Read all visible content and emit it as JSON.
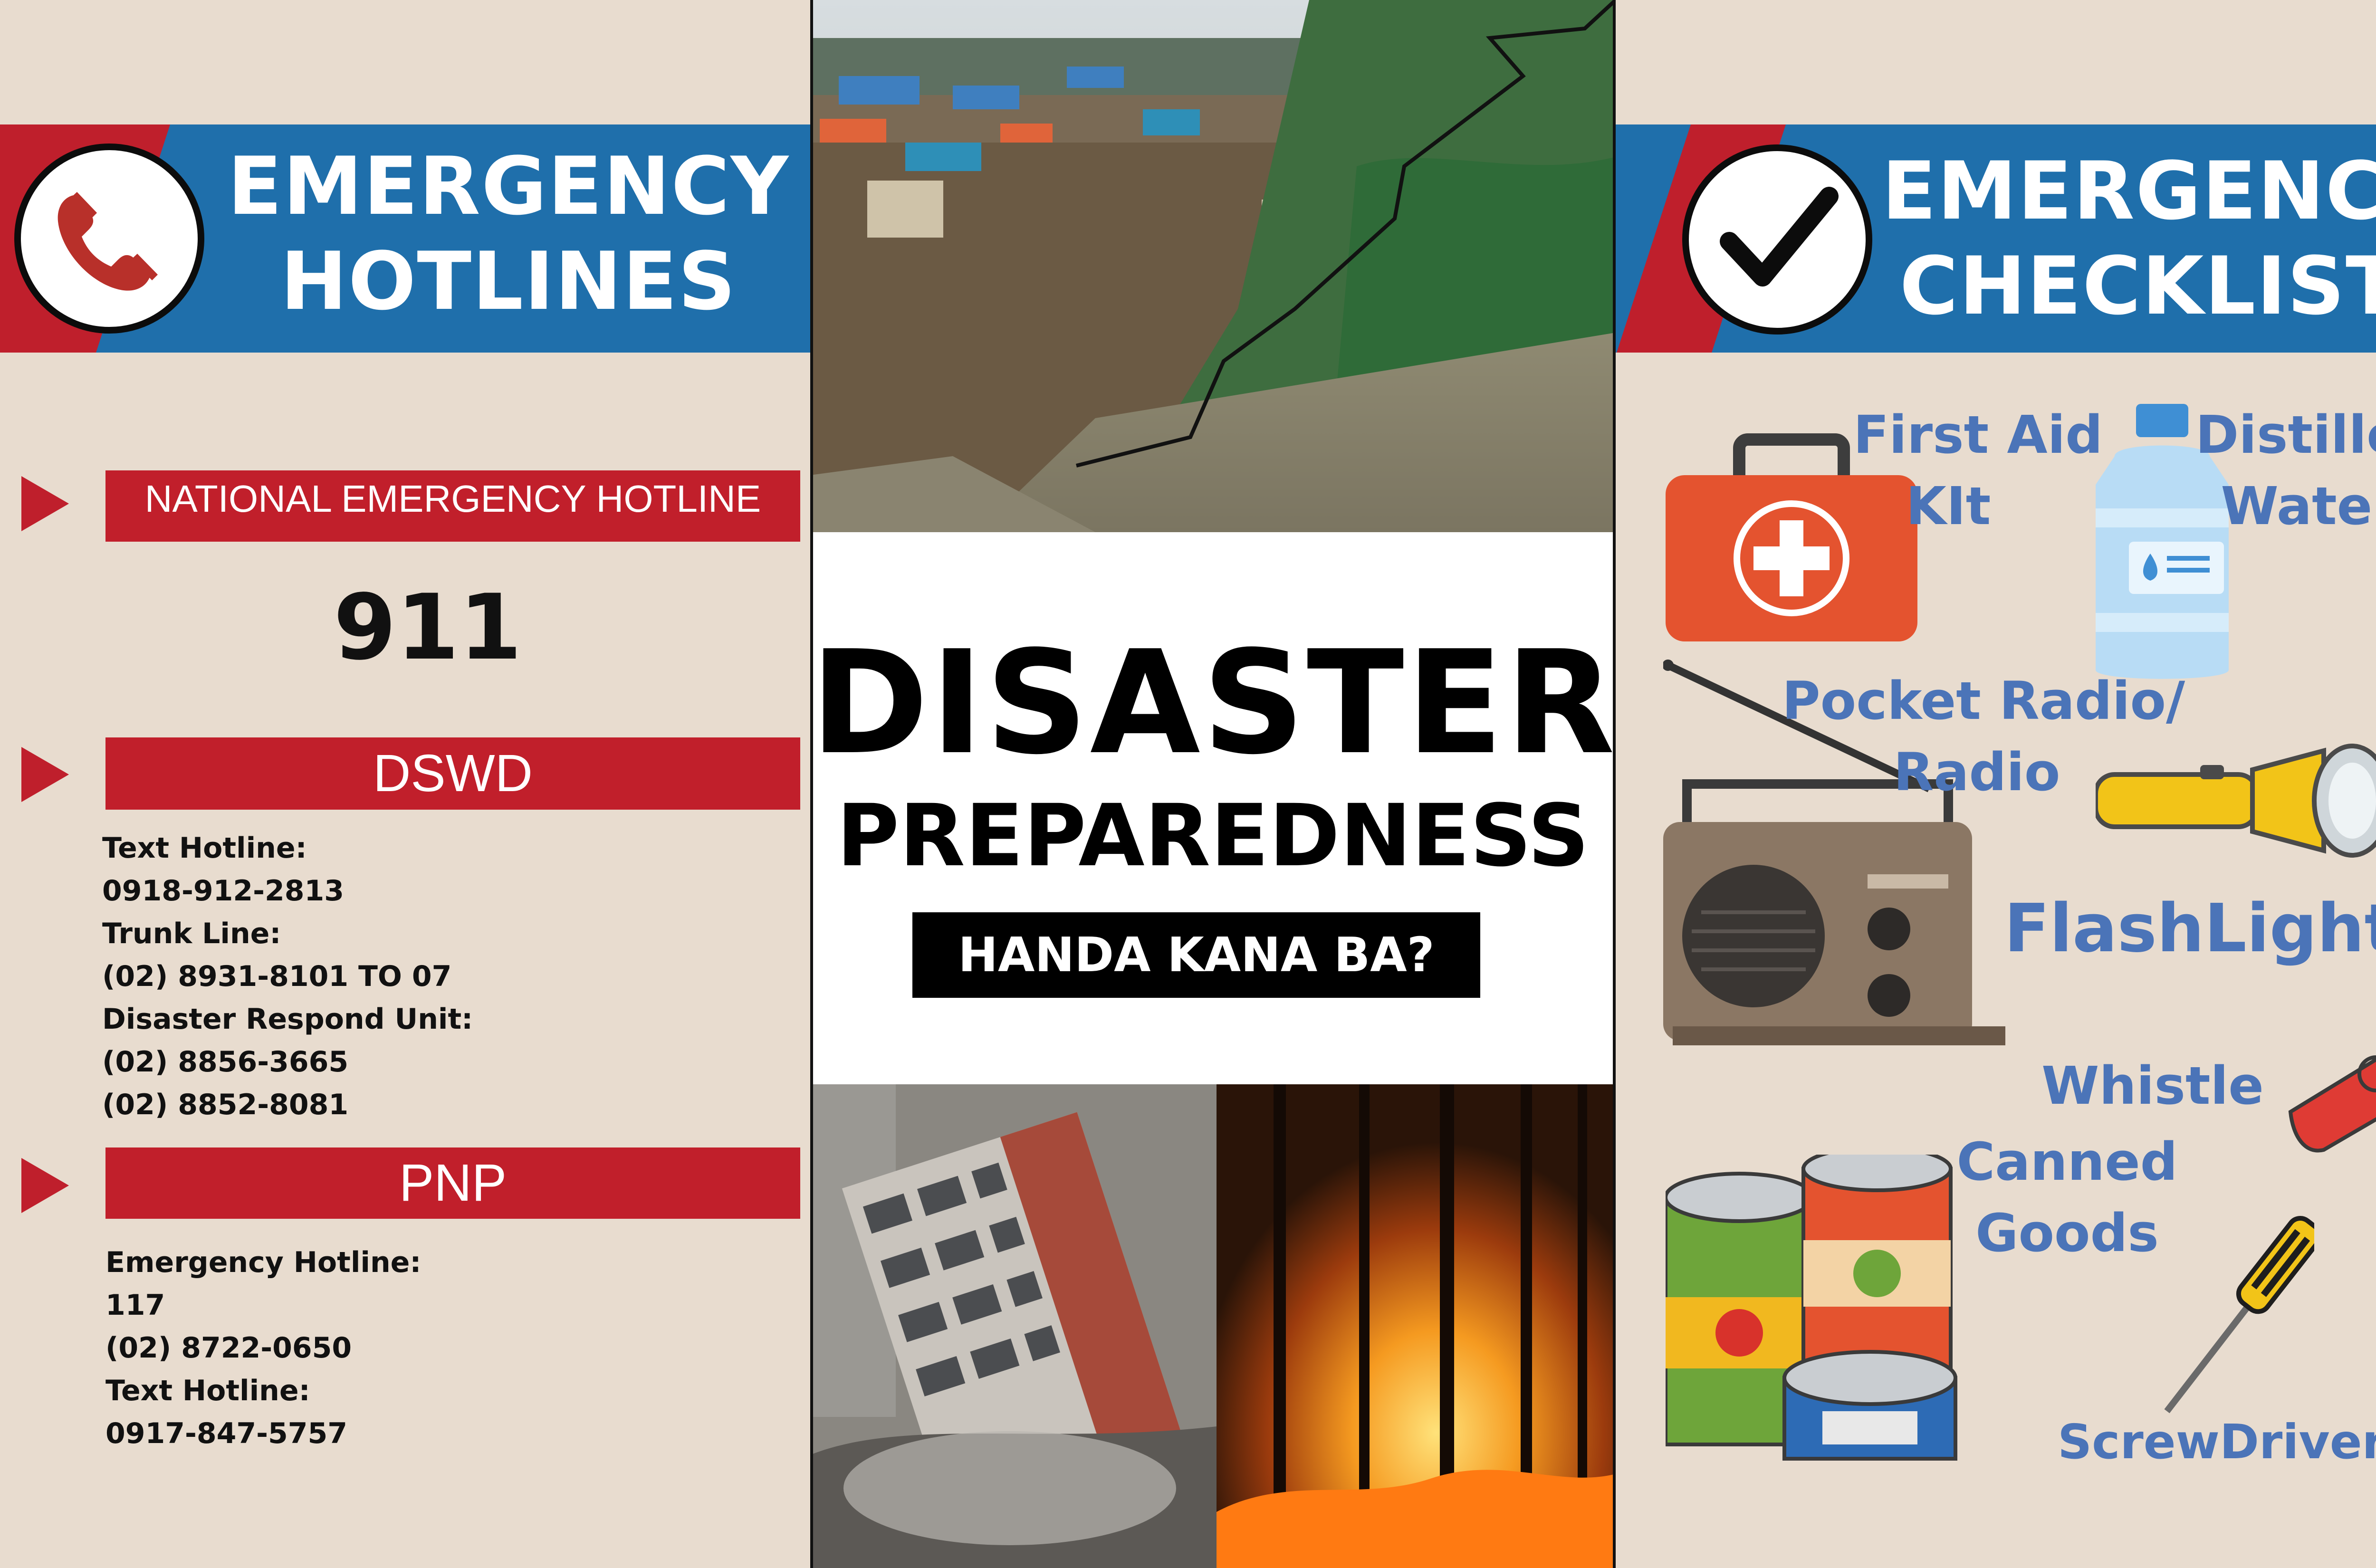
{
  "hotlines": {
    "title_line1": "EMERGENCY",
    "title_line2": "HOTLINES",
    "sections": [
      {
        "label": "NATIONAL EMERGENCY HOTLINE",
        "number": "911"
      },
      {
        "label": "DSWD",
        "lines": [
          "Text Hotline:",
          "0918-912-2813",
          "Trunk Line:",
          "(02) 8931-8101 TO 07",
          "Disaster Respond Unit:",
          "(02) 8856-3665",
          "(02) 8852-8081"
        ]
      },
      {
        "label": "PNP",
        "lines": [
          "Emergency Hotline:",
          "117",
          "(02) 8722-0650",
          "Text Hotline:",
          "0917-847-5757"
        ]
      }
    ]
  },
  "center": {
    "title_line1": "DISASTER",
    "title_line2": "PREPAREDNESS",
    "tagline": "HANDA KANA BA?"
  },
  "checklist": {
    "title_line1": "EMERGENCY",
    "title_line2": "CHECKLIST",
    "items": [
      {
        "label_line1": "First Aid",
        "label_line2": "KIt",
        "icon": "first-aid-kit-icon"
      },
      {
        "label_line1": "Distilled",
        "label_line2": "Water",
        "icon": "water-jug-icon"
      },
      {
        "label_line1": "Pocket Radio/",
        "label_line2": "Radio",
        "icon": "radio-icon"
      },
      {
        "label_line1": "FlashLight",
        "icon": "flashlight-icon"
      },
      {
        "label_line1": "Whistle",
        "icon": "whistle-icon"
      },
      {
        "label_line1": "Canned",
        "label_line2": "Goods",
        "icon": "canned-goods-icon"
      },
      {
        "label_line1": "ScrewDriver",
        "icon": "screwdriver-icon"
      }
    ]
  },
  "colors": {
    "banner_blue": "#1f6fab",
    "accent_red": "#c11f2b",
    "checklist_text": "#4b74b8",
    "background": "#e8dccf"
  }
}
